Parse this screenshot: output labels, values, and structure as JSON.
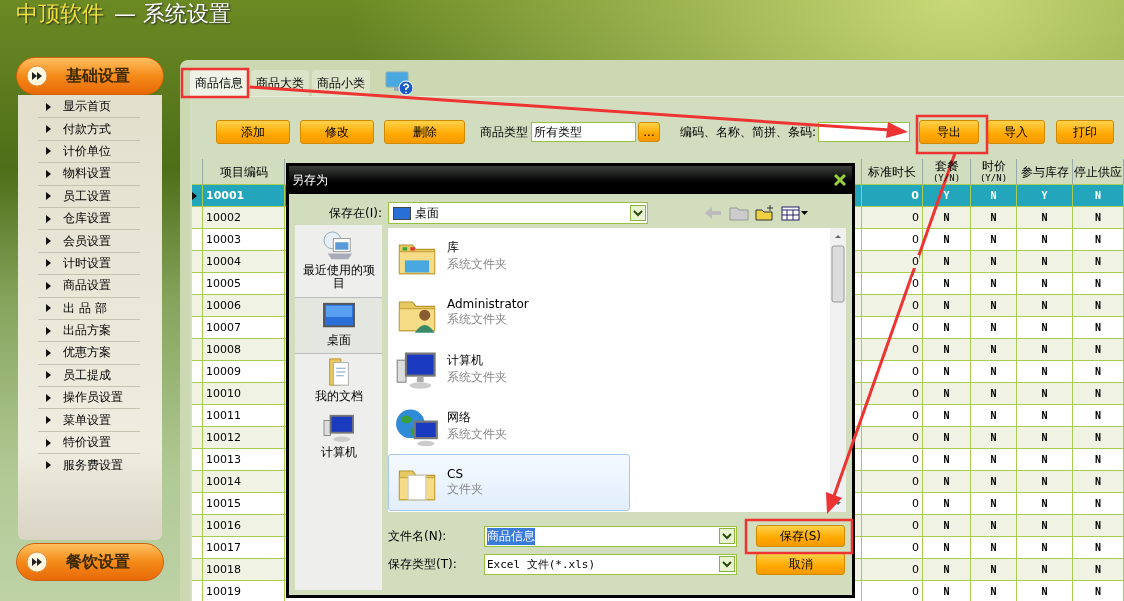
{
  "app_title": {
    "brand": "中顶软件",
    "page": "— 系统设置"
  },
  "sidebar": {
    "groups": [
      {
        "label": "基础设置",
        "expanded": true,
        "items": [
          "显示首页",
          "付款方式",
          "计价单位",
          "物料设置",
          "员工设置",
          "仓库设置",
          "会员设置",
          "计时设置",
          "商品设置",
          "出 品 部",
          "出品方案",
          "优惠方案",
          "员工提成",
          "操作员设置",
          "菜单设置",
          "特价设置",
          "服务费设置"
        ]
      },
      {
        "label": "餐饮设置",
        "expanded": false
      }
    ]
  },
  "tabs": [
    {
      "label": "商品信息",
      "selected": true
    },
    {
      "label": "商品大类",
      "selected": false
    },
    {
      "label": "商品小类",
      "selected": false
    }
  ],
  "toolbar": {
    "buttons_left": [
      "添加",
      "修改",
      "删除"
    ],
    "type_label": "商品类型",
    "type_value": "所有类型",
    "browse": "...",
    "search_label": "编码、名称、简拼、条码:",
    "buttons_right": [
      "导出",
      "导入",
      "打印"
    ]
  },
  "table": {
    "columns": [
      {
        "label": "项目编码"
      },
      {
        "label": "标准时长"
      },
      {
        "label": "套餐",
        "unit": "(Y/N)"
      },
      {
        "label": "时价",
        "unit": "(Y/N)"
      },
      {
        "label": "参与库存"
      },
      {
        "label": "停止供应"
      }
    ],
    "rows": [
      {
        "cells": [
          "10001",
          "0",
          "Y",
          "N",
          "Y",
          "N"
        ],
        "selected": true
      },
      {
        "cells": [
          "10002",
          "0",
          "N",
          "N",
          "N",
          "N"
        ],
        "selected": false
      },
      {
        "cells": [
          "10003",
          "0",
          "N",
          "N",
          "N",
          "N"
        ],
        "selected": false
      },
      {
        "cells": [
          "10004",
          "0",
          "N",
          "N",
          "N",
          "N"
        ],
        "selected": false
      },
      {
        "cells": [
          "10005",
          "0",
          "N",
          "N",
          "N",
          "N"
        ],
        "selected": false
      },
      {
        "cells": [
          "10006",
          "0",
          "N",
          "N",
          "N",
          "N"
        ],
        "selected": false
      },
      {
        "cells": [
          "10007",
          "0",
          "N",
          "N",
          "N",
          "N"
        ],
        "selected": false
      },
      {
        "cells": [
          "10008",
          "0",
          "N",
          "N",
          "N",
          "N"
        ],
        "selected": false
      },
      {
        "cells": [
          "10009",
          "0",
          "N",
          "N",
          "N",
          "N"
        ],
        "selected": false
      },
      {
        "cells": [
          "10010",
          "0",
          "N",
          "N",
          "N",
          "N"
        ],
        "selected": false
      },
      {
        "cells": [
          "10011",
          "0",
          "N",
          "N",
          "N",
          "N"
        ],
        "selected": false
      },
      {
        "cells": [
          "10012",
          "0",
          "N",
          "N",
          "N",
          "N"
        ],
        "selected": false
      },
      {
        "cells": [
          "10013",
          "0",
          "N",
          "N",
          "N",
          "N"
        ],
        "selected": false
      },
      {
        "cells": [
          "10014",
          "0",
          "N",
          "N",
          "N",
          "N"
        ],
        "selected": false
      },
      {
        "cells": [
          "10015",
          "0",
          "N",
          "N",
          "N",
          "N"
        ],
        "selected": false
      },
      {
        "cells": [
          "10016",
          "0",
          "N",
          "N",
          "N",
          "N"
        ],
        "selected": false
      },
      {
        "cells": [
          "10017",
          "0",
          "N",
          "N",
          "N",
          "N"
        ],
        "selected": false
      },
      {
        "cells": [
          "10018",
          "0",
          "N",
          "N",
          "N",
          "N"
        ],
        "selected": false
      },
      {
        "cells": [
          "10019",
          "0",
          "N",
          "N",
          "N",
          "N"
        ],
        "selected": false
      }
    ]
  },
  "dialog": {
    "title": "另存为",
    "save_in_label": "保存在(I):",
    "save_in_value": "桌面",
    "places": [
      {
        "label": "最近使用的项目",
        "kind": "recent",
        "selected": false
      },
      {
        "label": "桌面",
        "kind": "desktop",
        "selected": true
      },
      {
        "label": "我的文档",
        "kind": "documents",
        "selected": false
      },
      {
        "label": "计算机",
        "kind": "computer",
        "selected": false
      }
    ],
    "files": [
      {
        "name": "库",
        "type": "系统文件夹",
        "kind": "library",
        "selected": false
      },
      {
        "name": "Administrator",
        "type": "系统文件夹",
        "kind": "user",
        "selected": false
      },
      {
        "name": "计算机",
        "type": "系统文件夹",
        "kind": "computer",
        "selected": false
      },
      {
        "name": "网络",
        "type": "系统文件夹",
        "kind": "network",
        "selected": false
      },
      {
        "name": "CS",
        "type": "文件夹",
        "kind": "folder",
        "selected": true
      }
    ],
    "file_name_label": "文件名(N):",
    "file_name": "商品信息",
    "file_name_selected": true,
    "file_type_label": "保存类型(T):",
    "file_type": "Excel 文件(*.xls)",
    "buttons": [
      "保存(S)",
      "取消"
    ]
  }
}
